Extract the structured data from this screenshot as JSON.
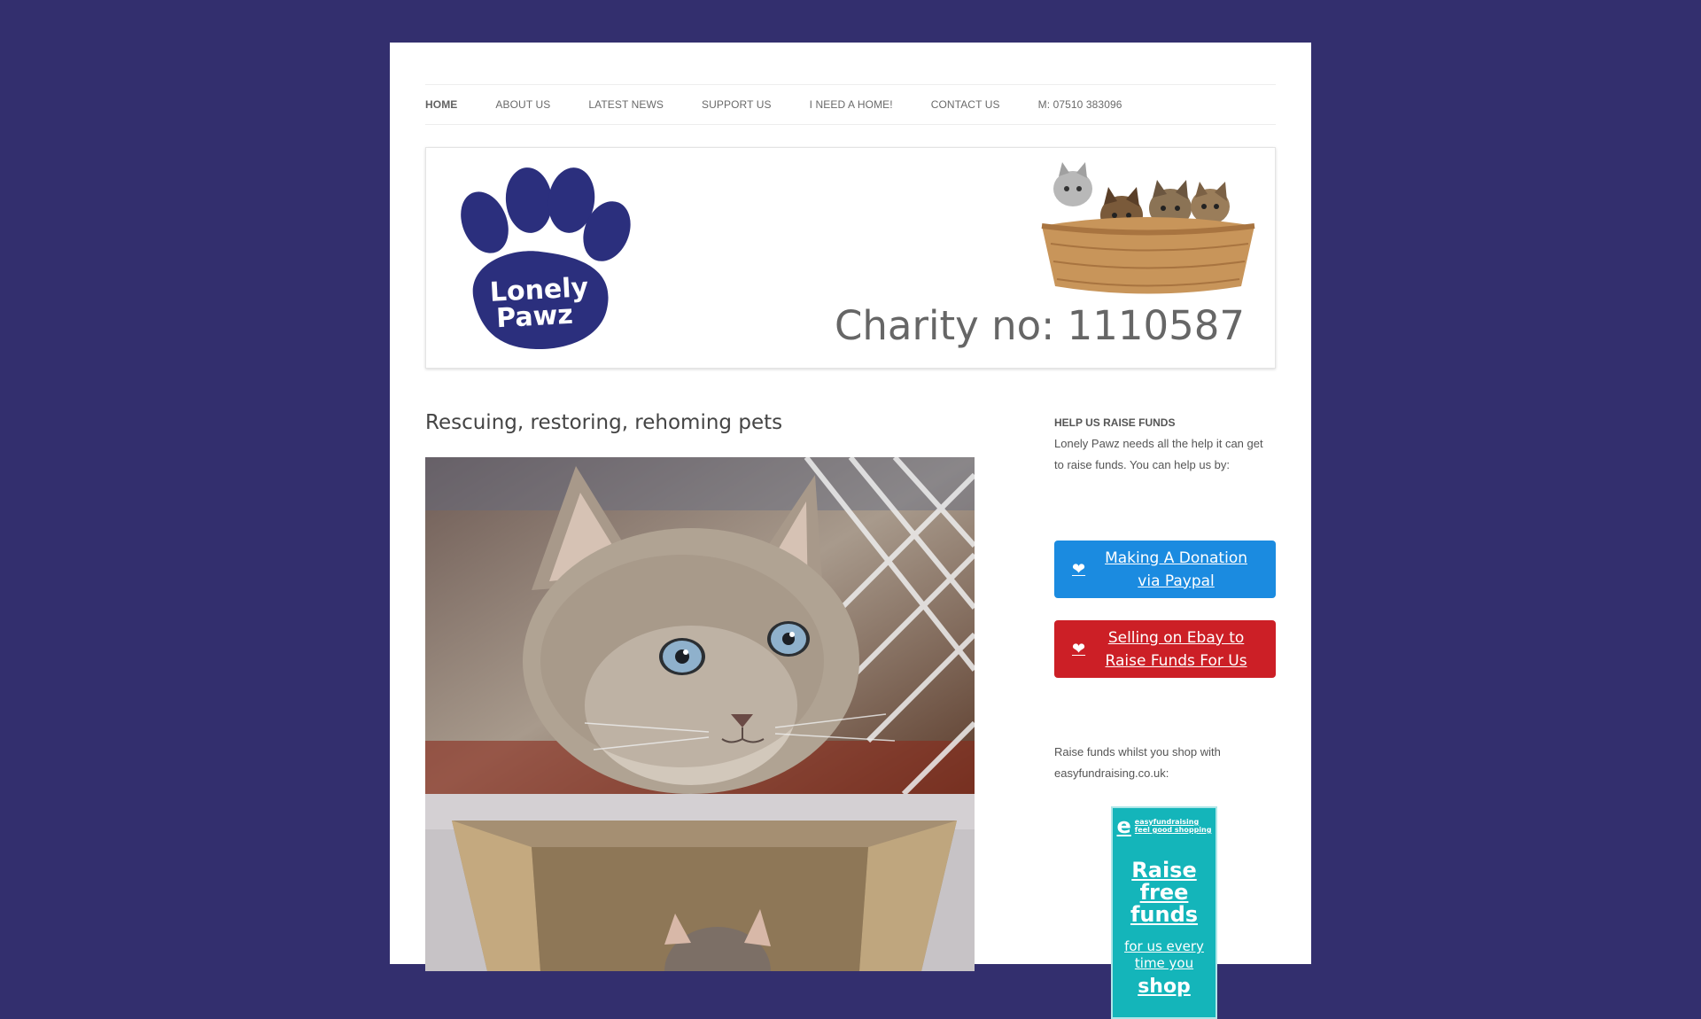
{
  "nav": {
    "items": [
      {
        "label": "HOME",
        "active": true
      },
      {
        "label": "ABOUT US",
        "active": false
      },
      {
        "label": "LATEST NEWS",
        "active": false
      },
      {
        "label": "SUPPORT US",
        "active": false
      },
      {
        "label": "I NEED A HOME!",
        "active": false
      },
      {
        "label": "CONTACT US",
        "active": false
      },
      {
        "label": "M: 07510 383096",
        "active": false
      }
    ]
  },
  "header": {
    "logo_text_line1": "Lonely",
    "logo_text_line2": "Pawz",
    "charity": "Charity no: 1110587",
    "brand_color": "#2b2f7d"
  },
  "main": {
    "title": "Rescuing, restoring, rehoming pets"
  },
  "sidebar": {
    "widget_title": "HELP US RAISE FUNDS",
    "widget_text": "Lonely Pawz needs all the help it can get to raise funds. You can help us by:",
    "donate_button": {
      "label": "Making A Donation via Paypal",
      "icon": "heart-icon",
      "color": "#1b8be0"
    },
    "ebay_button": {
      "label": "Selling on Ebay to Raise Funds For Us",
      "icon": "heart-icon",
      "color": "#cc1f26"
    },
    "raise_text": "Raise funds whilst you shop with easyfundraising.co.uk:",
    "ef_banner": {
      "logo_line1": "easyfundraising",
      "logo_line2": "feel good shopping",
      "big1": "Raise",
      "big2": "free",
      "big3": "funds",
      "small1": "for us every",
      "small2": "time you",
      "shop": "shop"
    }
  },
  "colors": {
    "background": "#332f6e",
    "page": "#ffffff"
  }
}
